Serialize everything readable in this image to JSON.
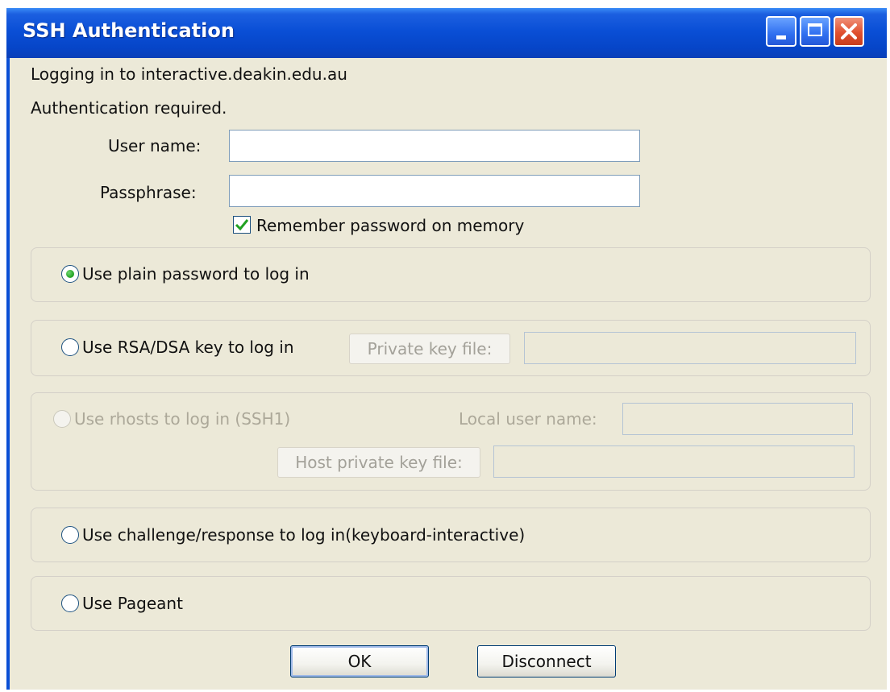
{
  "window": {
    "title": "SSH Authentication",
    "title_color": "#0A4FD6"
  },
  "header": {
    "logging_in": "Logging in to interactive.deakin.edu.au",
    "auth_required": "Authentication required."
  },
  "form": {
    "username_label": "User name:",
    "username_value": "",
    "passphrase_label": "Passphrase:",
    "passphrase_value": "",
    "remember_label": "Remember password on memory",
    "remember_checked": true
  },
  "methods": {
    "plain": {
      "label": "Use plain password to log in",
      "selected": true
    },
    "rsa": {
      "label": "Use RSA/DSA key to log in",
      "key_button": "Private key file:",
      "key_value": ""
    },
    "rhosts": {
      "label": "Use rhosts to log in (SSH1)",
      "local_user_label": "Local user name:",
      "local_user_value": "",
      "host_key_button": "Host private key file:",
      "host_key_value": ""
    },
    "challenge": {
      "label": "Use challenge/response to log in(keyboard-interactive)"
    },
    "pageant": {
      "label": "Use Pageant"
    }
  },
  "buttons": {
    "ok": "OK",
    "disconnect": "Disconnect"
  }
}
